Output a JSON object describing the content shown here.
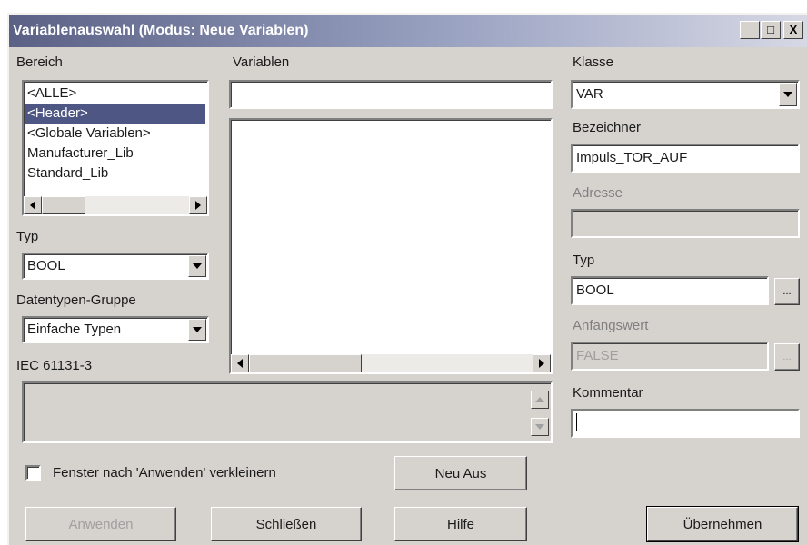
{
  "window": {
    "title": "Variablenauswahl (Modus: Neue Variablen)",
    "minimize_glyph": "_",
    "maximize_glyph": "□",
    "close_glyph": "X"
  },
  "left": {
    "bereich_label": "Bereich",
    "bereich_items": [
      "<ALLE>",
      "<Header>",
      "<Globale Variablen>",
      "Manufacturer_Lib",
      "Standard_Lib"
    ],
    "bereich_selected_index": 1,
    "typ_label": "Typ",
    "typ_value": "BOOL",
    "gruppe_label": "Datentypen-Gruppe",
    "gruppe_value": "Einfache Typen",
    "iec_label": "IEC 61131-3",
    "checkbox_label": "Fenster nach 'Anwenden' verkleinern",
    "checkbox_checked": false
  },
  "middle": {
    "variablen_label": "Variablen",
    "filter_value": ""
  },
  "right": {
    "klasse_label": "Klasse",
    "klasse_value": "VAR",
    "bezeichner_label": "Bezeichner",
    "bezeichner_value": "Impuls_TOR_AUF",
    "adresse_label": "Adresse",
    "adresse_value": "",
    "typ_label": "Typ",
    "typ_value": "BOOL",
    "typ_browse": "...",
    "anfangswert_label": "Anfangswert",
    "anfangswert_value": "FALSE",
    "anfangswert_browse": "...",
    "kommentar_label": "Kommentar",
    "kommentar_value": ""
  },
  "buttons": {
    "neu_aus": "Neu Aus",
    "anwenden": "Anwenden",
    "schliessen": "Schließen",
    "hilfe": "Hilfe",
    "uebernehmen": "Übernehmen"
  }
}
